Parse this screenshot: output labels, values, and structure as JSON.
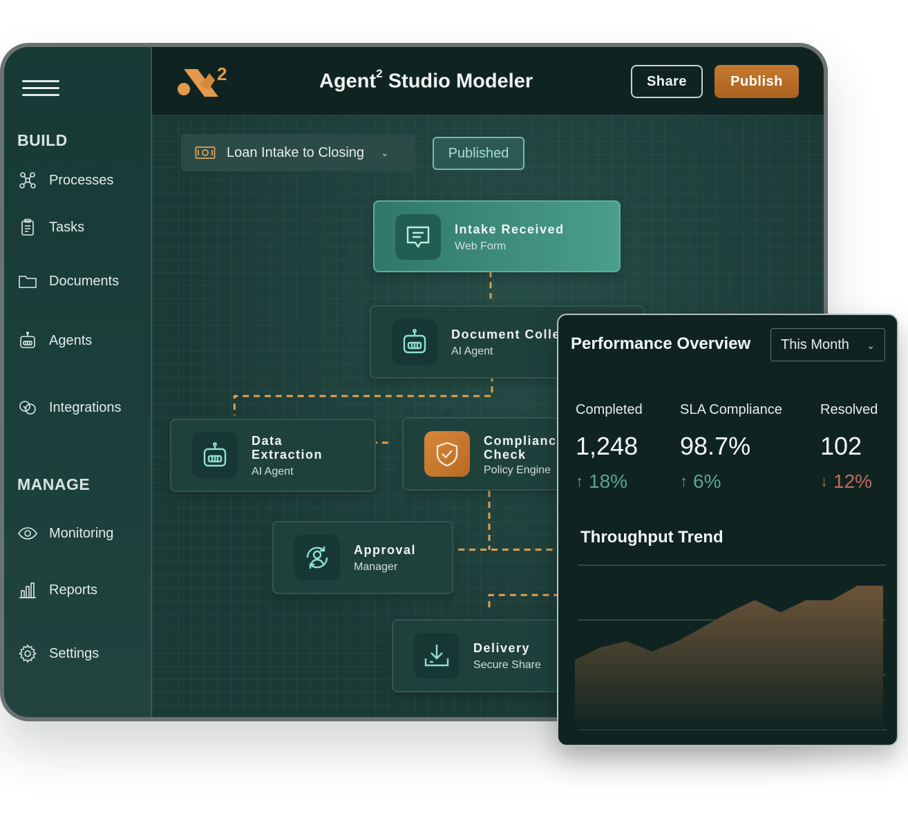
{
  "header": {
    "title": "Agent",
    "title_sup": "2",
    "title_rest": " Studio Modeler",
    "logo_sup": "2",
    "share_label": "Share",
    "publish_label": "Publish"
  },
  "sidebar": {
    "build_label": "BUILD",
    "manage_label": "MANAGE",
    "build_items": [
      {
        "label": "Processes",
        "icon": "processes-icon"
      },
      {
        "label": "Tasks",
        "icon": "clipboard-icon"
      },
      {
        "label": "Documents",
        "icon": "folder-icon"
      },
      {
        "label": "Agents",
        "icon": "robot-icon"
      },
      {
        "label": "Integrations",
        "icon": "integrations-icon"
      }
    ],
    "manage_items": [
      {
        "label": "Monitoring",
        "icon": "eye-icon"
      },
      {
        "label": "Reports",
        "icon": "bar-chart-icon"
      },
      {
        "label": "Settings",
        "icon": "gear-icon"
      }
    ]
  },
  "canvas": {
    "process_select": "Loan Intake to Closing",
    "status": "Published",
    "nodes": {
      "intake": {
        "title": "Intake Received",
        "sub": "Web Form"
      },
      "document": {
        "title": "Document Colle",
        "sub": "AI Agent"
      },
      "extraction": {
        "title_1": "Data",
        "title_2": "Extraction",
        "sub": "AI Agent"
      },
      "compliance": {
        "title_1": "Compliance",
        "title_2": "Check",
        "sub": "Policy Engine"
      },
      "approval": {
        "title": "Approval",
        "sub": "Manager"
      },
      "delivery": {
        "title": "Delivery",
        "sub": "Secure Share"
      }
    }
  },
  "performance": {
    "title": "Performance Overview",
    "period": "This Month",
    "metrics": [
      {
        "label": "Completed",
        "value": "1,248",
        "delta": "18%",
        "direction": "up"
      },
      {
        "label": "SLA Compliance",
        "value": "98.7%",
        "delta": "6%",
        "direction": "up"
      },
      {
        "label": "Resolved",
        "value": "102",
        "delta": "12%",
        "direction": "down"
      }
    ],
    "trend_title": "Throughput Trend",
    "colors": {
      "up": "#5fa58d",
      "down": "#c46a5e",
      "area": "#6d5438"
    }
  },
  "chart_data": {
    "type": "area",
    "title": "Throughput Trend",
    "x": [
      0,
      1,
      2,
      3,
      4,
      5,
      6,
      7,
      8,
      9,
      10,
      11,
      12
    ],
    "values": [
      34,
      40,
      43,
      38,
      43,
      50,
      57,
      63,
      57,
      63,
      63,
      70,
      70
    ],
    "ylim": [
      0,
      80
    ],
    "grid": true
  }
}
